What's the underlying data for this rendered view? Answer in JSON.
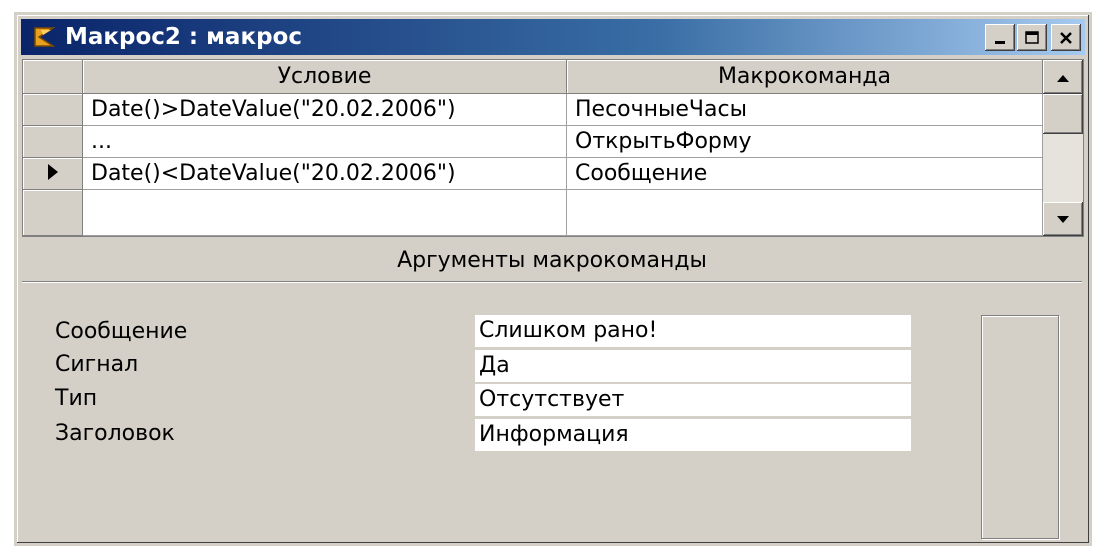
{
  "window": {
    "title": "Макрос2 : макрос",
    "icon": "macro-icon",
    "buttons": {
      "minimize": "minimize-icon",
      "maximize": "maximize-icon",
      "close": "close-icon"
    }
  },
  "grid": {
    "columns": [
      "Условие",
      "Макрокоманда"
    ],
    "rows": [
      {
        "condition": "Date()>DateValue(\"20.02.2006\")",
        "action": "ПесочныеЧасы",
        "current": false
      },
      {
        "condition": "...",
        "action": "ОткрытьФорму",
        "current": false
      },
      {
        "condition": "Date()<DateValue(\"20.02.2006\")",
        "action": "Сообщение",
        "current": true
      },
      {
        "condition": "",
        "action": "",
        "current": false
      }
    ]
  },
  "arguments": {
    "header": "Аргументы макрокоманды",
    "items": [
      {
        "label": "Сообщение",
        "value": "Слишком рано!"
      },
      {
        "label": "Сигнал",
        "value": "Да"
      },
      {
        "label": "Тип",
        "value": "Отсутствует"
      },
      {
        "label": "Заголовок",
        "value": "Информация"
      }
    ]
  },
  "colors": {
    "title_bar_start": "#0a246a",
    "title_bar_end": "#a6caf0",
    "face": "#d4d0c8"
  }
}
